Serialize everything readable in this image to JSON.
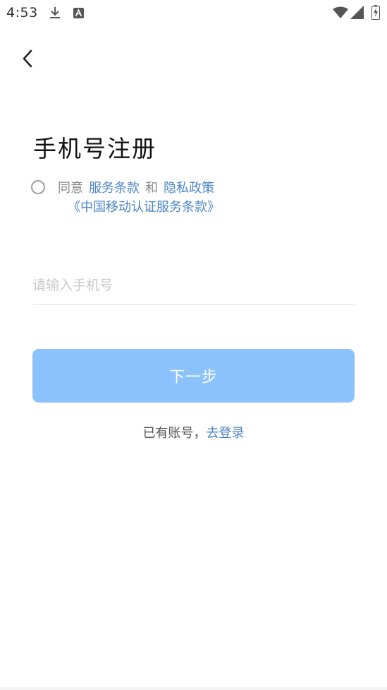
{
  "status_bar": {
    "time": "4:53",
    "icons": [
      "download-icon",
      "text-a-icon",
      "wifi-icon",
      "signal-icon",
      "battery-charging-icon"
    ]
  },
  "nav": {
    "back_icon": "chevron-left-icon"
  },
  "title": "手机号注册",
  "agreement": {
    "prefix": "同意",
    "terms_link": "服务条款",
    "and": "和",
    "privacy_link": "隐私政策",
    "cmcc_link": "《中国移动认证服务条款》"
  },
  "phone_input": {
    "value": "",
    "placeholder": "请输入手机号"
  },
  "next_button": {
    "label": "下一步",
    "color": "#8bc2fc"
  },
  "login_prompt": {
    "prefix": "已有账号，",
    "link": "去登录"
  },
  "colors": {
    "link": "#4a86c8",
    "muted": "#888888",
    "placeholder": "#c8c8c8"
  }
}
